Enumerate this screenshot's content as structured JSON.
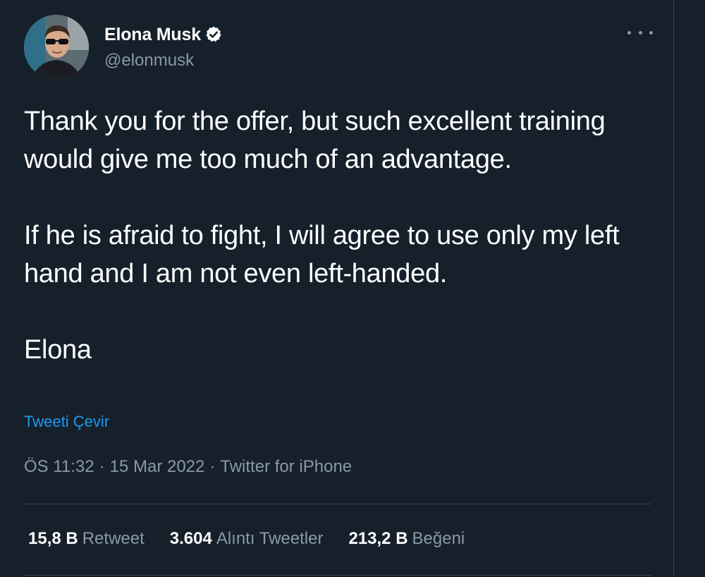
{
  "author": {
    "display_name": "Elona Musk",
    "handle": "@elonmusk",
    "verified": true,
    "avatar": "profile-photo-man-in-sunglasses"
  },
  "tweet": {
    "paragraphs": [
      "Thank you for the offer, but such excellent training would give me too much of an advantage.",
      "If he is afraid to fight, I will agree to use only my left hand and I am not even left-handed.",
      "Elona"
    ],
    "translate_link": "Tweeti Çevir",
    "time": "ÖS 11:32",
    "date": "15 Mar 2022",
    "source": "Twitter for iPhone",
    "separator": "·"
  },
  "stats": {
    "retweets": {
      "count": "15,8 B",
      "label": "Retweet"
    },
    "quotes": {
      "count": "3.604",
      "label": "Alıntı Tweetler"
    },
    "likes": {
      "count": "213,2 B",
      "label": "Beğeni"
    }
  },
  "icons": {
    "more": "more-horizontal-icon",
    "verified": "verified-badge-icon"
  },
  "colors": {
    "background": "#15202b",
    "text": "#ffffff",
    "muted": "#8b98a5",
    "link": "#1d9bf0",
    "divider": "#38444d"
  }
}
